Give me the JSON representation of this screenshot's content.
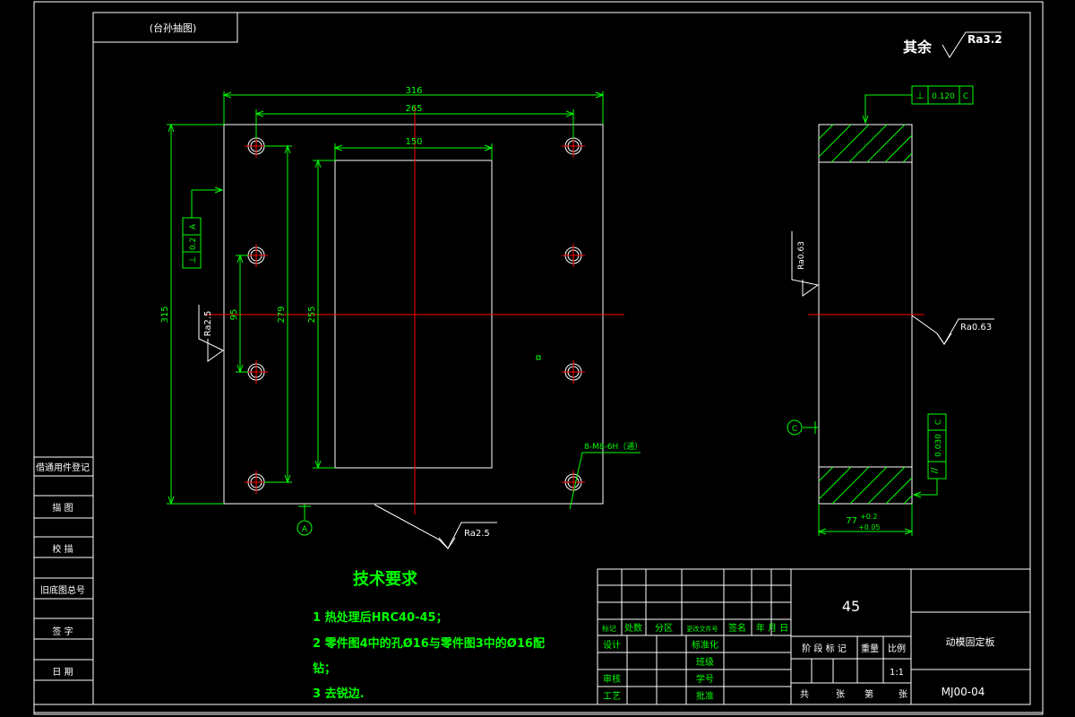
{
  "header_box": {
    "label": "(台孙抽图)"
  },
  "surface_finish": {
    "prefix": "其余",
    "value": "Ra3.2"
  },
  "front_view": {
    "dims": {
      "width_overall": "316",
      "hole_spacing_x": "265",
      "pocket_width": "150",
      "height_overall": "315",
      "hole_spacing_y": "279",
      "pocket_height": "255",
      "inner_spacing": "95"
    },
    "roughness_left": "Ra2.5",
    "roughness_bottom": "Ra2.5",
    "perp_tol": {
      "symbol": "⊥",
      "value": "0.2",
      "datum": "A"
    },
    "thread_note": "8-M8-6H（通）",
    "datum": "A"
  },
  "side_view": {
    "perp_tol": {
      "symbol": "⊥",
      "value": "0.120",
      "datum": "C"
    },
    "parallel_tol": {
      "symbol": "//",
      "value": "0.030",
      "datum": "C"
    },
    "roughness_top": "Ra0.63",
    "roughness_right": "Ra0.63",
    "datum": "C",
    "thickness": "77",
    "tol_upper": "+0.2",
    "tol_lower": "+0.05"
  },
  "tech_requirements": {
    "title": "技术要求",
    "items": [
      "1  热处理后HRC40-45；",
      "2  零件图4中的孔Ø16与零件图3中的Ø16配",
      "钻；",
      "3  去锐边."
    ]
  },
  "left_column": [
    "借通用件登记",
    "描  图",
    "校  描",
    "旧底图总号",
    "签  字",
    "日  期"
  ],
  "title_block": {
    "material": "45",
    "part_name": "动模固定板",
    "drawing_no": "MJ00-04",
    "header_row": [
      "标记",
      "处数",
      "分区",
      "更改文件号",
      "签名",
      "年 月 日"
    ],
    "roles": [
      "设计",
      "审核",
      "工艺"
    ],
    "center_roles": [
      "标准化",
      "班级",
      "学号",
      "批准"
    ],
    "stage_header": [
      "阶 段 标 记",
      "重量",
      "比例"
    ],
    "scale": "1:1",
    "sheet_row": [
      "共",
      "张",
      "第",
      "张"
    ]
  }
}
